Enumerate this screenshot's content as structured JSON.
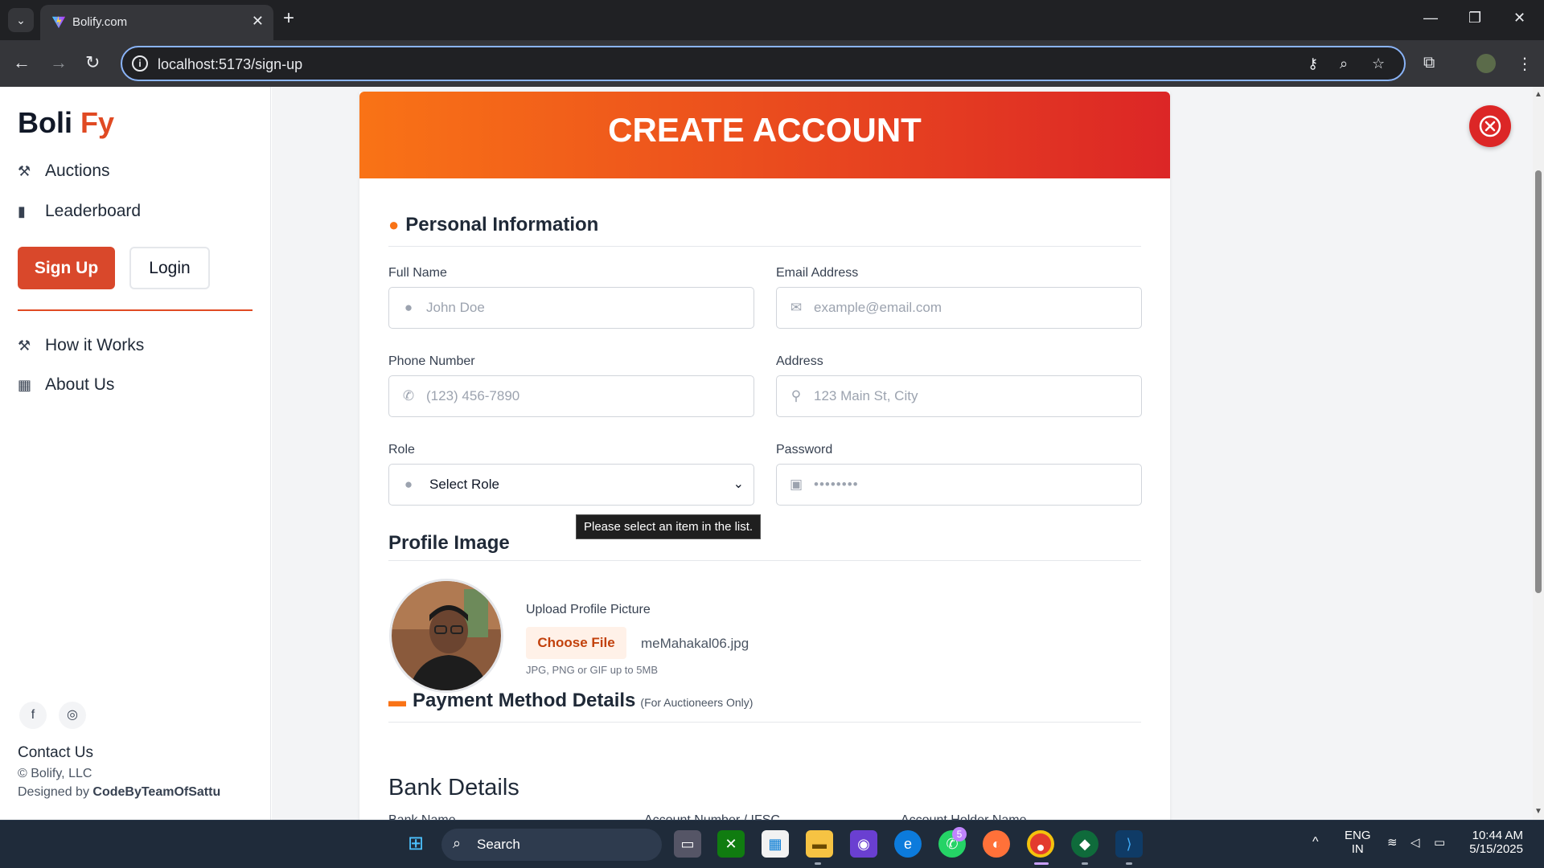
{
  "browser": {
    "tab_title": "Bolify.com",
    "url": "localhost:5173/sign-up"
  },
  "sidebar": {
    "logo_main": "Boli ",
    "logo_accent": "Fy",
    "nav": [
      {
        "label": "Auctions",
        "icon": "gavel-icon"
      },
      {
        "label": "Leaderboard",
        "icon": "bar-chart-icon"
      },
      {
        "label": "How it Works",
        "icon": "gavel-icon"
      },
      {
        "label": "About Us",
        "icon": "building-icon"
      }
    ],
    "signup_label": "Sign Up",
    "login_label": "Login",
    "contact": "Contact Us",
    "copyright": "© Bolify, LLC",
    "designed_prefix": "Designed by ",
    "designed_by": "CodeByTeamOfSattu"
  },
  "form": {
    "title": "CREATE ACCOUNT",
    "personal_title": "Personal Information",
    "full_name_label": "Full Name",
    "full_name_placeholder": "John Doe",
    "email_label": "Email Address",
    "email_placeholder": "example@email.com",
    "phone_label": "Phone Number",
    "phone_placeholder": "(123) 456-7890",
    "address_label": "Address",
    "address_placeholder": "123 Main St, City",
    "role_label": "Role",
    "role_value": "Select Role",
    "password_label": "Password",
    "password_value": "••••••••",
    "tooltip": "Please select an item in the list.",
    "profile_title": "Profile Image",
    "upload_label": "Upload Profile Picture",
    "choose_file": "Choose File",
    "file_name": "meMahakal06.jpg",
    "file_hint": "JPG, PNG or GIF up to 5MB",
    "payment_title": "Payment Method Details",
    "payment_note": "(For Auctioneers Only)",
    "bank_title": "Bank Details",
    "bank_cols": [
      "Bank Name",
      "Account Number / IFSC",
      "Account Holder Name"
    ]
  },
  "taskbar": {
    "search": "Search",
    "whatsapp_badge": "5",
    "lang1": "ENG",
    "lang2": "IN",
    "time": "10:44 AM",
    "date": "5/15/2025"
  },
  "colors": {
    "accent": "#e04a23",
    "header_start": "#f97316",
    "header_end": "#dc2626"
  }
}
